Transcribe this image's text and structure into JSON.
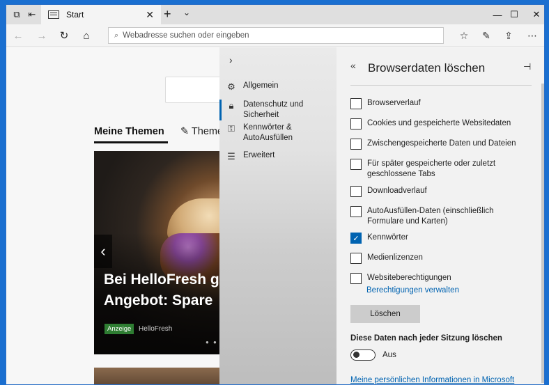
{
  "browser": {
    "tab_title": "Start",
    "new_tab": "+",
    "tab_menu": "⌄",
    "address_placeholder": "Webadresse suchen oder eingeben",
    "controls": {
      "minimize": "—",
      "maximize": "☐",
      "close": "✕"
    }
  },
  "page": {
    "topics_label": "Meine Themen",
    "topics_edit_label": "Themen",
    "card": {
      "headline": "Bei HelloFresh g Angebot: Spare",
      "ad_badge": "Anzeige",
      "source": "HelloFresh",
      "dots": "● ● ●"
    }
  },
  "settings_nav": {
    "items": [
      {
        "icon": "gear-icon",
        "label": "Allgemein"
      },
      {
        "icon": "lock-icon",
        "label": "Datenschutz und Sicherheit"
      },
      {
        "icon": "key-icon",
        "label": "Kennwörter & AutoAusfüllen"
      },
      {
        "icon": "sliders-icon",
        "label": "Erweitert"
      }
    ]
  },
  "panel": {
    "title": "Browserdaten löschen",
    "options": [
      {
        "label": "Browserverlauf",
        "checked": false
      },
      {
        "label": "Cookies und gespeicherte Websitedaten",
        "checked": false
      },
      {
        "label": "Zwischengespeicherte Daten und Dateien",
        "checked": false
      },
      {
        "label": "Für später gespeicherte oder zuletzt geschlossene Tabs",
        "checked": false
      },
      {
        "label": "Downloadverlauf",
        "checked": false
      },
      {
        "label": "AutoAusfüllen-Daten (einschließlich Formulare und Karten)",
        "checked": false
      },
      {
        "label": "Kennwörter",
        "checked": true
      },
      {
        "label": "Medienlizenzen",
        "checked": false
      },
      {
        "label": "Websiteberechtigungen",
        "checked": false
      }
    ],
    "permissions_link": "Berechtigungen verwalten",
    "clear_button": "Löschen",
    "session_label": "Diese Daten nach jeder Sitzung löschen",
    "toggle_state": "Aus",
    "info_link": "Meine persönlichen Informationen in Microsoft"
  }
}
